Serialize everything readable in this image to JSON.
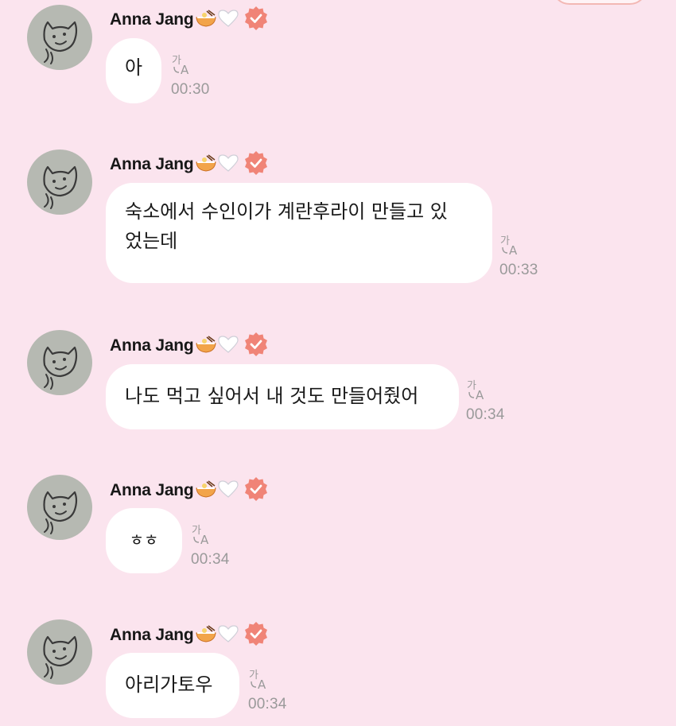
{
  "sender": {
    "name": "Anna Jang",
    "name_emojis": [
      "ramen-emoji",
      "white-heart-emoji"
    ],
    "verified_color": "#f08477",
    "avatar_bg": "#b6b9b2"
  },
  "colors": {
    "background": "#fbe4ee",
    "bubble": "#ffffff",
    "timestamp": "#9a9a9a"
  },
  "messages": [
    {
      "text": "아",
      "time": "00:30"
    },
    {
      "text": "숙소에서 수인이가 계란후라이 만들고 있었는데",
      "line1": "숙소에서 수인이가 계란후라이 만들고 있",
      "line2": "었는데",
      "time": "00:33"
    },
    {
      "text": "나도 먹고 싶어서 내 것도 만들어줬어",
      "time": "00:34"
    },
    {
      "text": "ㅎㅎ",
      "time": "00:34"
    },
    {
      "text": "아리가토우",
      "time": "00:34"
    }
  ]
}
